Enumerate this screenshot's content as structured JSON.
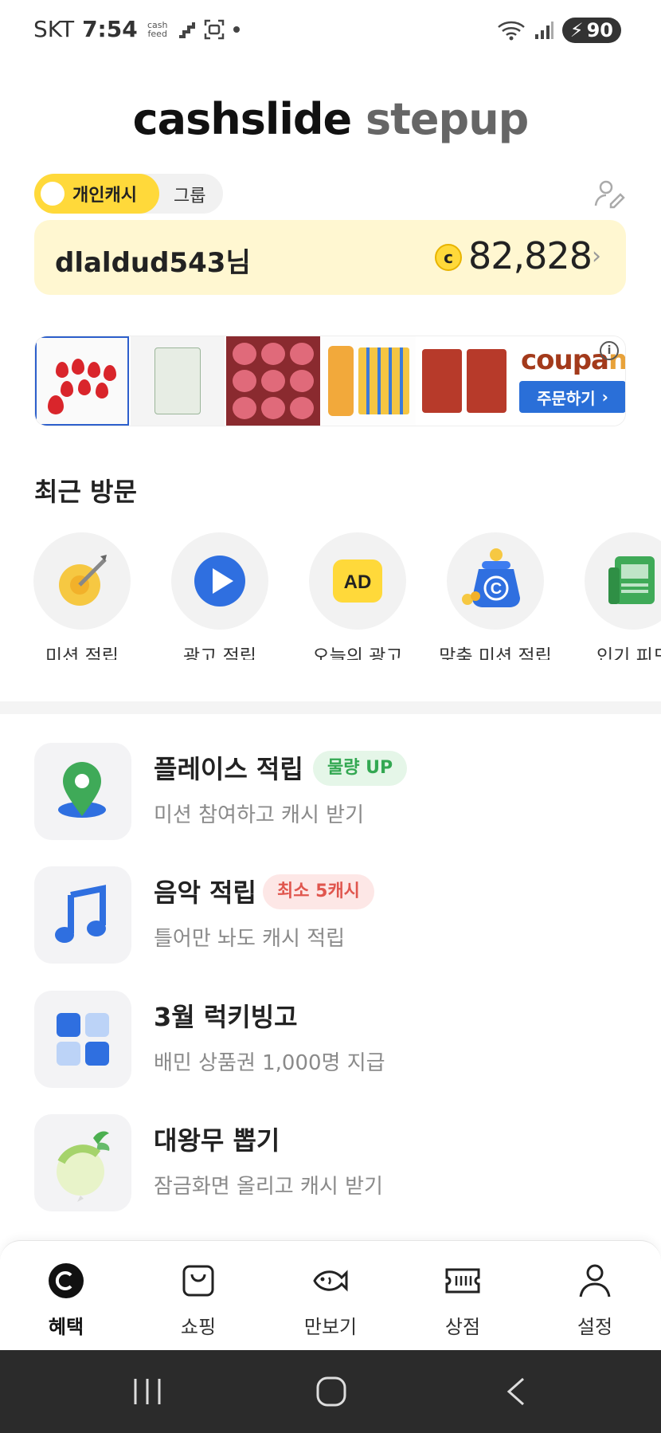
{
  "status_bar": {
    "carrier": "SKT",
    "time": "7:54",
    "feed_icon_text": "cash feed",
    "battery": "90",
    "wifi_label": "5"
  },
  "logo": {
    "part1": "cashslide",
    "part2": "stepup"
  },
  "cash_toggle": {
    "active_label": "개인캐시",
    "inactive_label": "그룹"
  },
  "cash_card": {
    "username": "dlaldud543님",
    "coin_symbol": "c",
    "amount": "82,828"
  },
  "ad_banner": {
    "brand": "coupang",
    "cta": "주문하기",
    "info": "i"
  },
  "recent": {
    "title": "최근 방문",
    "items": [
      {
        "label": "미션 적립",
        "icon": "target-icon"
      },
      {
        "label": "광고 적립",
        "icon": "play-icon"
      },
      {
        "label": "오늘의 광고",
        "icon": "ad-icon",
        "icon_text": "AD"
      },
      {
        "label": "맞춤 미션 적립",
        "icon": "coin-bag-icon",
        "icon_text": "C"
      },
      {
        "label": "인기 피드",
        "icon": "newspaper-icon"
      }
    ]
  },
  "list": [
    {
      "title": "플레이스 적립",
      "badge": "물량 UP",
      "badge_color": "#33a852",
      "subtitle": "미션 참여하고 캐시 받기",
      "icon": "map-pin-icon"
    },
    {
      "title": "음악 적립",
      "badge": "최소 5캐시",
      "badge_color": "#e0564e",
      "subtitle": "틀어만 놔도 캐시 적립",
      "icon": "music-note-icon"
    },
    {
      "title": "3월 럭키빙고",
      "badge": "",
      "subtitle": "배민 상품권 1,000명 지급",
      "icon": "bingo-grid-icon"
    },
    {
      "title": "대왕무 뽑기",
      "badge": "",
      "subtitle": "잠금화면 올리고 캐시 받기",
      "icon": "radish-icon"
    }
  ],
  "bottom_nav": [
    {
      "label": "혜택",
      "icon": "benefit-coin-icon",
      "active": true
    },
    {
      "label": "쇼핑",
      "icon": "shopping-bag-icon",
      "active": false
    },
    {
      "label": "만보기",
      "icon": "fish-pedometer-icon",
      "active": false
    },
    {
      "label": "상점",
      "icon": "store-ticket-icon",
      "active": false
    },
    {
      "label": "설정",
      "icon": "person-icon",
      "active": false
    }
  ],
  "colors": {
    "accent_yellow": "#ffd93a",
    "card_bg": "#fff7d1",
    "coupang_blue": "#2a6fd8"
  }
}
